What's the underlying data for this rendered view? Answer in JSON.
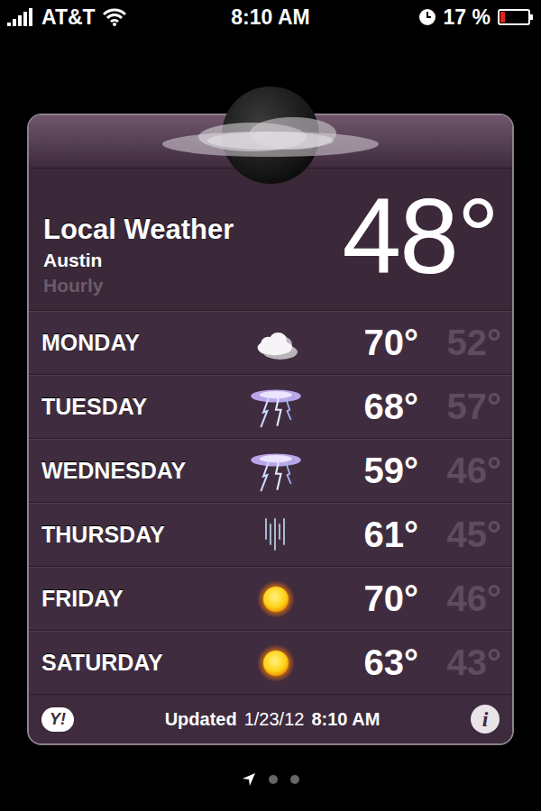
{
  "status_bar": {
    "carrier": "AT&T",
    "signal_level": 1,
    "wifi": true,
    "time": "8:10 AM",
    "alarm": true,
    "battery": "17 %",
    "battery_level": 0.17
  },
  "location": {
    "title": "Local Weather",
    "city": "Austin",
    "mode": "Hourly"
  },
  "current": {
    "temperature": "48°",
    "kind": "cloud-moon"
  },
  "forecast": [
    {
      "day": "MONDAY",
      "high": "70°",
      "low": "52°",
      "kind": "cloud"
    },
    {
      "day": "TUESDAY",
      "high": "68°",
      "low": "57°",
      "kind": "storm"
    },
    {
      "day": "WEDNESDAY",
      "high": "59°",
      "low": "46°",
      "kind": "storm"
    },
    {
      "day": "THURSDAY",
      "high": "61°",
      "low": "45°",
      "kind": "rain"
    },
    {
      "day": "FRIDAY",
      "high": "70°",
      "low": "46°",
      "kind": "sun"
    },
    {
      "day": "SATURDAY",
      "high": "63°",
      "low": "43°",
      "kind": "sun"
    }
  ],
  "footer": {
    "provider": "Y!",
    "updated_label": "Updated",
    "updated_date": "1/23/12",
    "updated_time": "8:10 AM",
    "info": "i"
  },
  "pages": [
    {
      "kind": "location",
      "selected": true
    },
    {
      "kind": "dot",
      "selected": false
    },
    {
      "kind": "dot",
      "selected": false
    }
  ]
}
